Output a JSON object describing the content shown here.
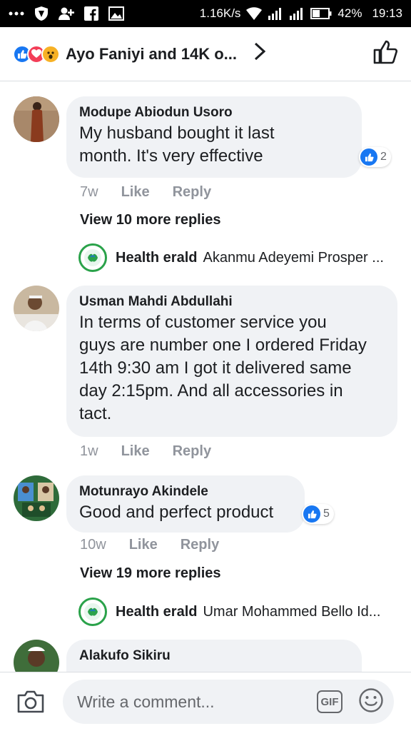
{
  "status_bar": {
    "left_icons": [
      "more-dots-icon",
      "shield-icon",
      "add-friend-icon",
      "facebook-icon",
      "gallery-icon"
    ],
    "network_speed": "1.16K/s",
    "battery": "42%",
    "time": "19:13"
  },
  "header": {
    "reactions": [
      "like",
      "love",
      "wow"
    ],
    "title": "Ayo Faniyi and 14K o...",
    "chevron": "›"
  },
  "comments": [
    {
      "author": "Modupe Abiodun Usoro",
      "text_lines": [
        "My husband bought it last",
        "month. It's very effective"
      ],
      "reaction_count": "2",
      "time": "7w",
      "like_label": "Like",
      "reply_label": "Reply",
      "view_more": "View 10 more replies",
      "reply_preview": {
        "name": "Health erald",
        "text": "Akanmu Adeyemi Prosper ..."
      }
    },
    {
      "author": "Usman Mahdi Abdullahi",
      "text_lines": [
        "In terms of customer service you",
        "guys are number one I ordered Friday",
        "14th 9:30 am I got it delivered  same",
        "day 2:15pm. And all accessories in",
        "tact."
      ],
      "time": "1w",
      "like_label": "Like",
      "reply_label": "Reply"
    },
    {
      "author": "Motunrayo Akindele",
      "text_lines": [
        "Good and perfect product"
      ],
      "reaction_count": "5",
      "time": "10w",
      "like_label": "Like",
      "reply_label": "Reply",
      "view_more": "View 19 more replies",
      "reply_preview": {
        "name": "Health erald",
        "text": "Umar Mohammed Bello Id..."
      }
    },
    {
      "author": "Alakufo Sikiru"
    }
  ],
  "composer": {
    "placeholder": "Write a comment...",
    "gif_label": "GIF"
  },
  "colors": {
    "accent": "#1877f2",
    "bubble": "#f0f2f5",
    "meta": "#90949c",
    "health_logo": "#2aa24a"
  }
}
